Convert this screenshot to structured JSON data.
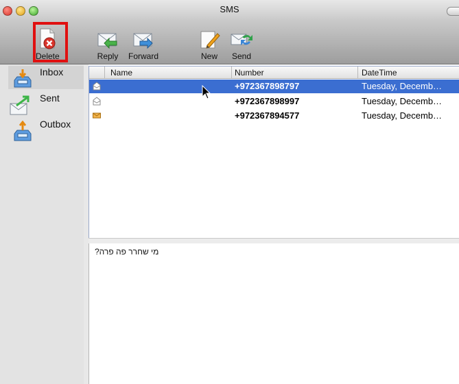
{
  "window": {
    "title": "SMS"
  },
  "toolbar": {
    "delete_label": "Delete",
    "reply_label": "Reply",
    "forward_label": "Forward",
    "new_label": "New",
    "send_label": "Send"
  },
  "sidebar": {
    "items": [
      {
        "label": "Inbox",
        "icon": "inbox-tray-icon"
      },
      {
        "label": "Sent",
        "icon": "sent-envelope-icon"
      },
      {
        "label": "Outbox",
        "icon": "outbox-tray-icon"
      }
    ]
  },
  "table": {
    "headers": {
      "name": "Name",
      "number": "Number",
      "datetime": "DateTime"
    },
    "rows": [
      {
        "name": "",
        "number": "+972367898797",
        "datetime": "Tuesday, Decemb…",
        "icon": "read-envelope-icon",
        "selected": true
      },
      {
        "name": "",
        "number": "+972367898997",
        "datetime": "Tuesday, Decemb…",
        "icon": "read-envelope-icon",
        "selected": false
      },
      {
        "name": "",
        "number": "+972367894577",
        "datetime": "Tuesday, Decemb…",
        "icon": "unread-envelope-icon",
        "selected": false
      }
    ]
  },
  "message": {
    "body": "מי שחרר פה פרה?"
  },
  "colors": {
    "selection": "#3b6ed1",
    "highlight_box": "#e01010"
  }
}
